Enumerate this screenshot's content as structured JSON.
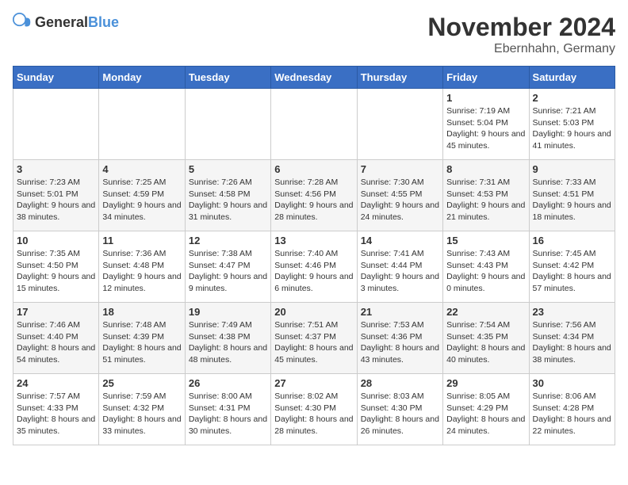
{
  "header": {
    "logo_general": "General",
    "logo_blue": "Blue",
    "month_title": "November 2024",
    "location": "Ebernhahn, Germany"
  },
  "days_of_week": [
    "Sunday",
    "Monday",
    "Tuesday",
    "Wednesday",
    "Thursday",
    "Friday",
    "Saturday"
  ],
  "weeks": [
    [
      {
        "day": "",
        "info": ""
      },
      {
        "day": "",
        "info": ""
      },
      {
        "day": "",
        "info": ""
      },
      {
        "day": "",
        "info": ""
      },
      {
        "day": "",
        "info": ""
      },
      {
        "day": "1",
        "info": "Sunrise: 7:19 AM\nSunset: 5:04 PM\nDaylight: 9 hours and 45 minutes."
      },
      {
        "day": "2",
        "info": "Sunrise: 7:21 AM\nSunset: 5:03 PM\nDaylight: 9 hours and 41 minutes."
      }
    ],
    [
      {
        "day": "3",
        "info": "Sunrise: 7:23 AM\nSunset: 5:01 PM\nDaylight: 9 hours and 38 minutes."
      },
      {
        "day": "4",
        "info": "Sunrise: 7:25 AM\nSunset: 4:59 PM\nDaylight: 9 hours and 34 minutes."
      },
      {
        "day": "5",
        "info": "Sunrise: 7:26 AM\nSunset: 4:58 PM\nDaylight: 9 hours and 31 minutes."
      },
      {
        "day": "6",
        "info": "Sunrise: 7:28 AM\nSunset: 4:56 PM\nDaylight: 9 hours and 28 minutes."
      },
      {
        "day": "7",
        "info": "Sunrise: 7:30 AM\nSunset: 4:55 PM\nDaylight: 9 hours and 24 minutes."
      },
      {
        "day": "8",
        "info": "Sunrise: 7:31 AM\nSunset: 4:53 PM\nDaylight: 9 hours and 21 minutes."
      },
      {
        "day": "9",
        "info": "Sunrise: 7:33 AM\nSunset: 4:51 PM\nDaylight: 9 hours and 18 minutes."
      }
    ],
    [
      {
        "day": "10",
        "info": "Sunrise: 7:35 AM\nSunset: 4:50 PM\nDaylight: 9 hours and 15 minutes."
      },
      {
        "day": "11",
        "info": "Sunrise: 7:36 AM\nSunset: 4:48 PM\nDaylight: 9 hours and 12 minutes."
      },
      {
        "day": "12",
        "info": "Sunrise: 7:38 AM\nSunset: 4:47 PM\nDaylight: 9 hours and 9 minutes."
      },
      {
        "day": "13",
        "info": "Sunrise: 7:40 AM\nSunset: 4:46 PM\nDaylight: 9 hours and 6 minutes."
      },
      {
        "day": "14",
        "info": "Sunrise: 7:41 AM\nSunset: 4:44 PM\nDaylight: 9 hours and 3 minutes."
      },
      {
        "day": "15",
        "info": "Sunrise: 7:43 AM\nSunset: 4:43 PM\nDaylight: 9 hours and 0 minutes."
      },
      {
        "day": "16",
        "info": "Sunrise: 7:45 AM\nSunset: 4:42 PM\nDaylight: 8 hours and 57 minutes."
      }
    ],
    [
      {
        "day": "17",
        "info": "Sunrise: 7:46 AM\nSunset: 4:40 PM\nDaylight: 8 hours and 54 minutes."
      },
      {
        "day": "18",
        "info": "Sunrise: 7:48 AM\nSunset: 4:39 PM\nDaylight: 8 hours and 51 minutes."
      },
      {
        "day": "19",
        "info": "Sunrise: 7:49 AM\nSunset: 4:38 PM\nDaylight: 8 hours and 48 minutes."
      },
      {
        "day": "20",
        "info": "Sunrise: 7:51 AM\nSunset: 4:37 PM\nDaylight: 8 hours and 45 minutes."
      },
      {
        "day": "21",
        "info": "Sunrise: 7:53 AM\nSunset: 4:36 PM\nDaylight: 8 hours and 43 minutes."
      },
      {
        "day": "22",
        "info": "Sunrise: 7:54 AM\nSunset: 4:35 PM\nDaylight: 8 hours and 40 minutes."
      },
      {
        "day": "23",
        "info": "Sunrise: 7:56 AM\nSunset: 4:34 PM\nDaylight: 8 hours and 38 minutes."
      }
    ],
    [
      {
        "day": "24",
        "info": "Sunrise: 7:57 AM\nSunset: 4:33 PM\nDaylight: 8 hours and 35 minutes."
      },
      {
        "day": "25",
        "info": "Sunrise: 7:59 AM\nSunset: 4:32 PM\nDaylight: 8 hours and 33 minutes."
      },
      {
        "day": "26",
        "info": "Sunrise: 8:00 AM\nSunset: 4:31 PM\nDaylight: 8 hours and 30 minutes."
      },
      {
        "day": "27",
        "info": "Sunrise: 8:02 AM\nSunset: 4:30 PM\nDaylight: 8 hours and 28 minutes."
      },
      {
        "day": "28",
        "info": "Sunrise: 8:03 AM\nSunset: 4:30 PM\nDaylight: 8 hours and 26 minutes."
      },
      {
        "day": "29",
        "info": "Sunrise: 8:05 AM\nSunset: 4:29 PM\nDaylight: 8 hours and 24 minutes."
      },
      {
        "day": "30",
        "info": "Sunrise: 8:06 AM\nSunset: 4:28 PM\nDaylight: 8 hours and 22 minutes."
      }
    ]
  ]
}
